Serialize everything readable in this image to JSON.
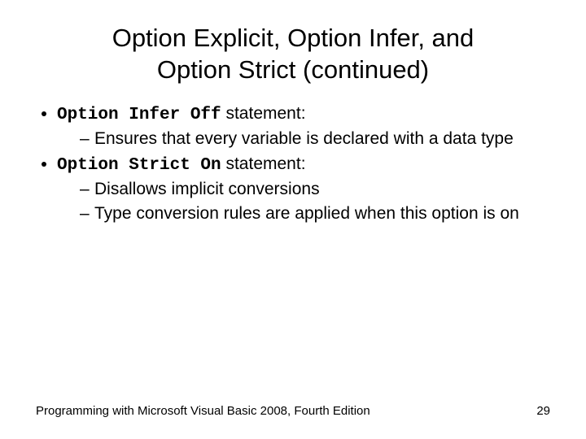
{
  "title_line1": "Option Explicit, Option Infer, and",
  "title_line2": "Option Strict (continued)",
  "bullets": {
    "b1_code": "Option Infer Off",
    "b1_rest": " statement:",
    "b1_sub1": "Ensures that every variable is declared with a data type",
    "b2_code": "Option Strict On",
    "b2_rest": " statement:",
    "b2_sub1": "Disallows implicit conversions",
    "b2_sub2": "Type conversion rules are applied when this option is on"
  },
  "footer_left": "Programming with Microsoft Visual Basic 2008, Fourth Edition",
  "footer_right": "29"
}
